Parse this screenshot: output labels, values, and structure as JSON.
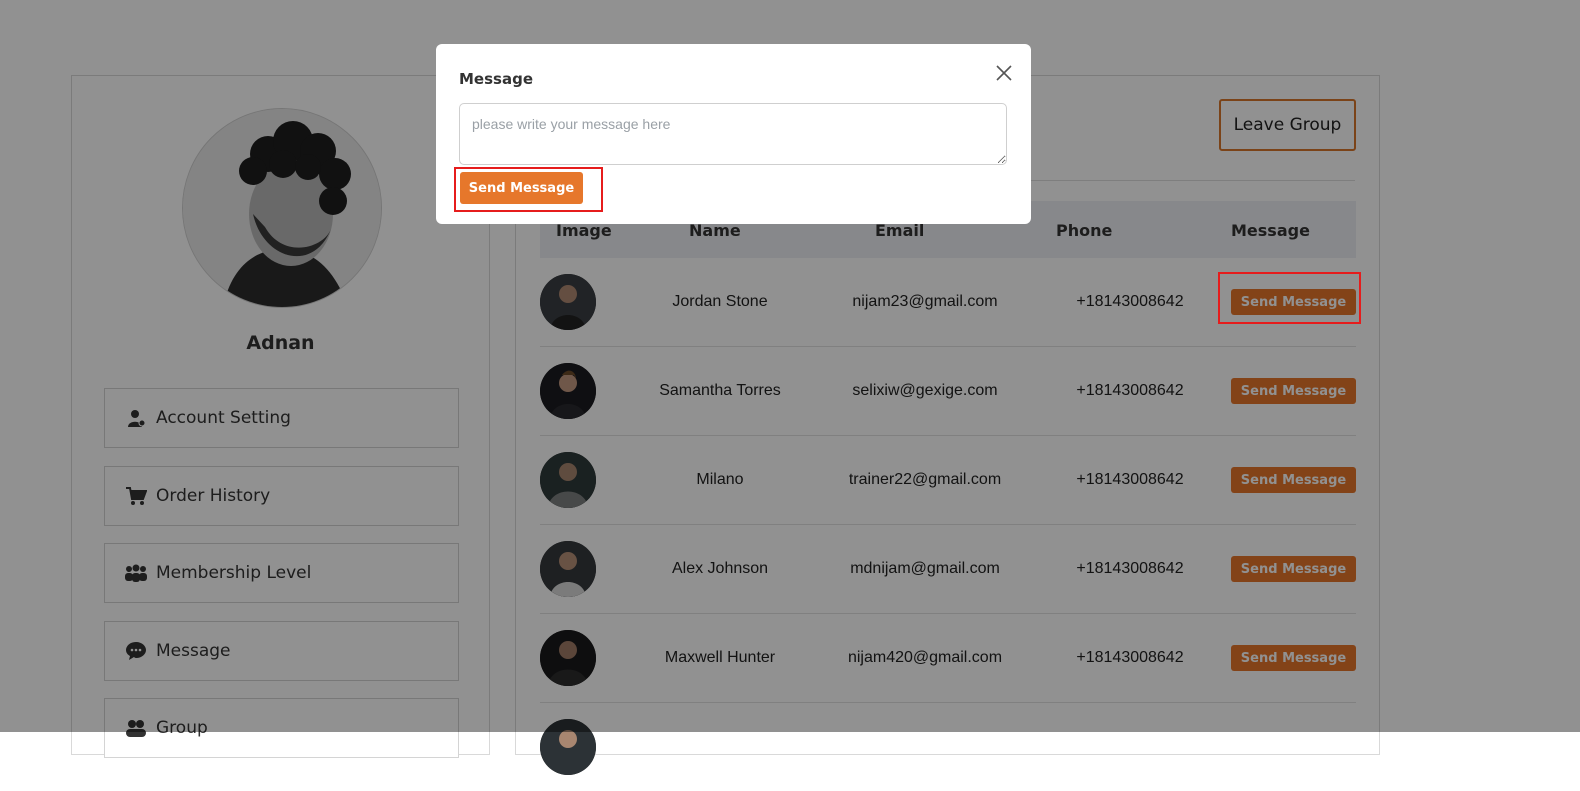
{
  "profile": {
    "name": "Adnan"
  },
  "sidebar": {
    "items": [
      {
        "label": "Account Setting",
        "icon": "user-gear-icon"
      },
      {
        "label": "Order History",
        "icon": "cart-icon"
      },
      {
        "label": "Membership Level",
        "icon": "users-icon"
      },
      {
        "label": "Message",
        "icon": "chat-icon"
      },
      {
        "label": "Group",
        "icon": "group-icon"
      }
    ]
  },
  "main": {
    "leave_group_label": "Leave Group",
    "columns": [
      "Image",
      "Name",
      "Email",
      "Phone",
      "Message"
    ],
    "rows": [
      {
        "name": "Jordan Stone",
        "email": "nijam23@gmail.com",
        "phone": "+18143008642",
        "action": "Send Message"
      },
      {
        "name": "Samantha Torres",
        "email": "selixiw@gexige.com",
        "phone": "+18143008642",
        "action": "Send Message"
      },
      {
        "name": "Milano",
        "email": "trainer22@gmail.com",
        "phone": "+18143008642",
        "action": "Send Message"
      },
      {
        "name": "Alex Johnson",
        "email": "mdnijam@gmail.com",
        "phone": "+18143008642",
        "action": "Send Message"
      },
      {
        "name": "Maxwell Hunter",
        "email": "nijam420@gmail.com",
        "phone": "+18143008642",
        "action": "Send Message"
      }
    ]
  },
  "modal": {
    "title": "Message",
    "placeholder": "please write your message here",
    "send_label": "Send Message"
  },
  "colors": {
    "accent": "#e6772b",
    "highlight": "#e61c1c",
    "overlay": "rgba(0,0,0,0.43)"
  }
}
